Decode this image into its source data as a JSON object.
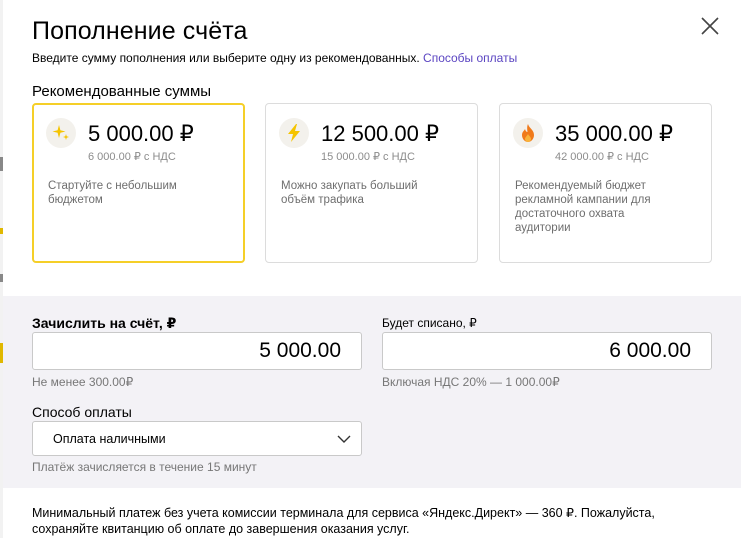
{
  "dialog": {
    "title": "Пополнение счёта",
    "subtitle": "Введите сумму пополнения или выберите одну из рекомендованных.",
    "payment_methods_link": "Способы оплаты"
  },
  "recommended": {
    "label": "Рекомендованные суммы",
    "cards": [
      {
        "icon": "sparkles-icon",
        "amount": "5 000.00 ₽",
        "vat": "6 000.00 ₽ с НДС",
        "description": "Стартуйте с небольшим бюджетом",
        "selected": true
      },
      {
        "icon": "lightning-icon",
        "amount": "12 500.00 ₽",
        "vat": "15 000.00 ₽ с НДС",
        "description": "Можно закупать больший объём трафика",
        "selected": false
      },
      {
        "icon": "fire-icon",
        "amount": "35 000.00 ₽",
        "vat": "42 000.00 ₽ с НДС",
        "description": "Рекомендуемый бюджет рекламной кампании для достаточного охвата аудитории",
        "selected": false
      }
    ]
  },
  "form": {
    "credit_label": "Зачислить на счёт, ₽",
    "credit_value": "5 000.00",
    "credit_hint": "Не менее 300.00₽",
    "debit_label": "Будет списано, ₽",
    "debit_value": "6 000.00",
    "debit_hint": "Включая НДС 20% — 1 000.00₽",
    "payment_label": "Способ оплаты",
    "payment_value": "Оплата наличными",
    "payment_hint": "Платёж зачисляется в течение 15 минут"
  },
  "footer": {
    "note": "Минимальный платеж без учета комиссии терминала для сервиса «Яндекс.Директ» — 360 ₽. Пожалуйста, сохраняйте квитанцию об оплате до завершения оказания услуг."
  },
  "colors": {
    "accent_selected": "#f5cf28",
    "link": "#5b45c2",
    "form_background": "#f3f2f6",
    "icon_yellow": "#f5c400",
    "icon_orange": "#f07a1a"
  }
}
